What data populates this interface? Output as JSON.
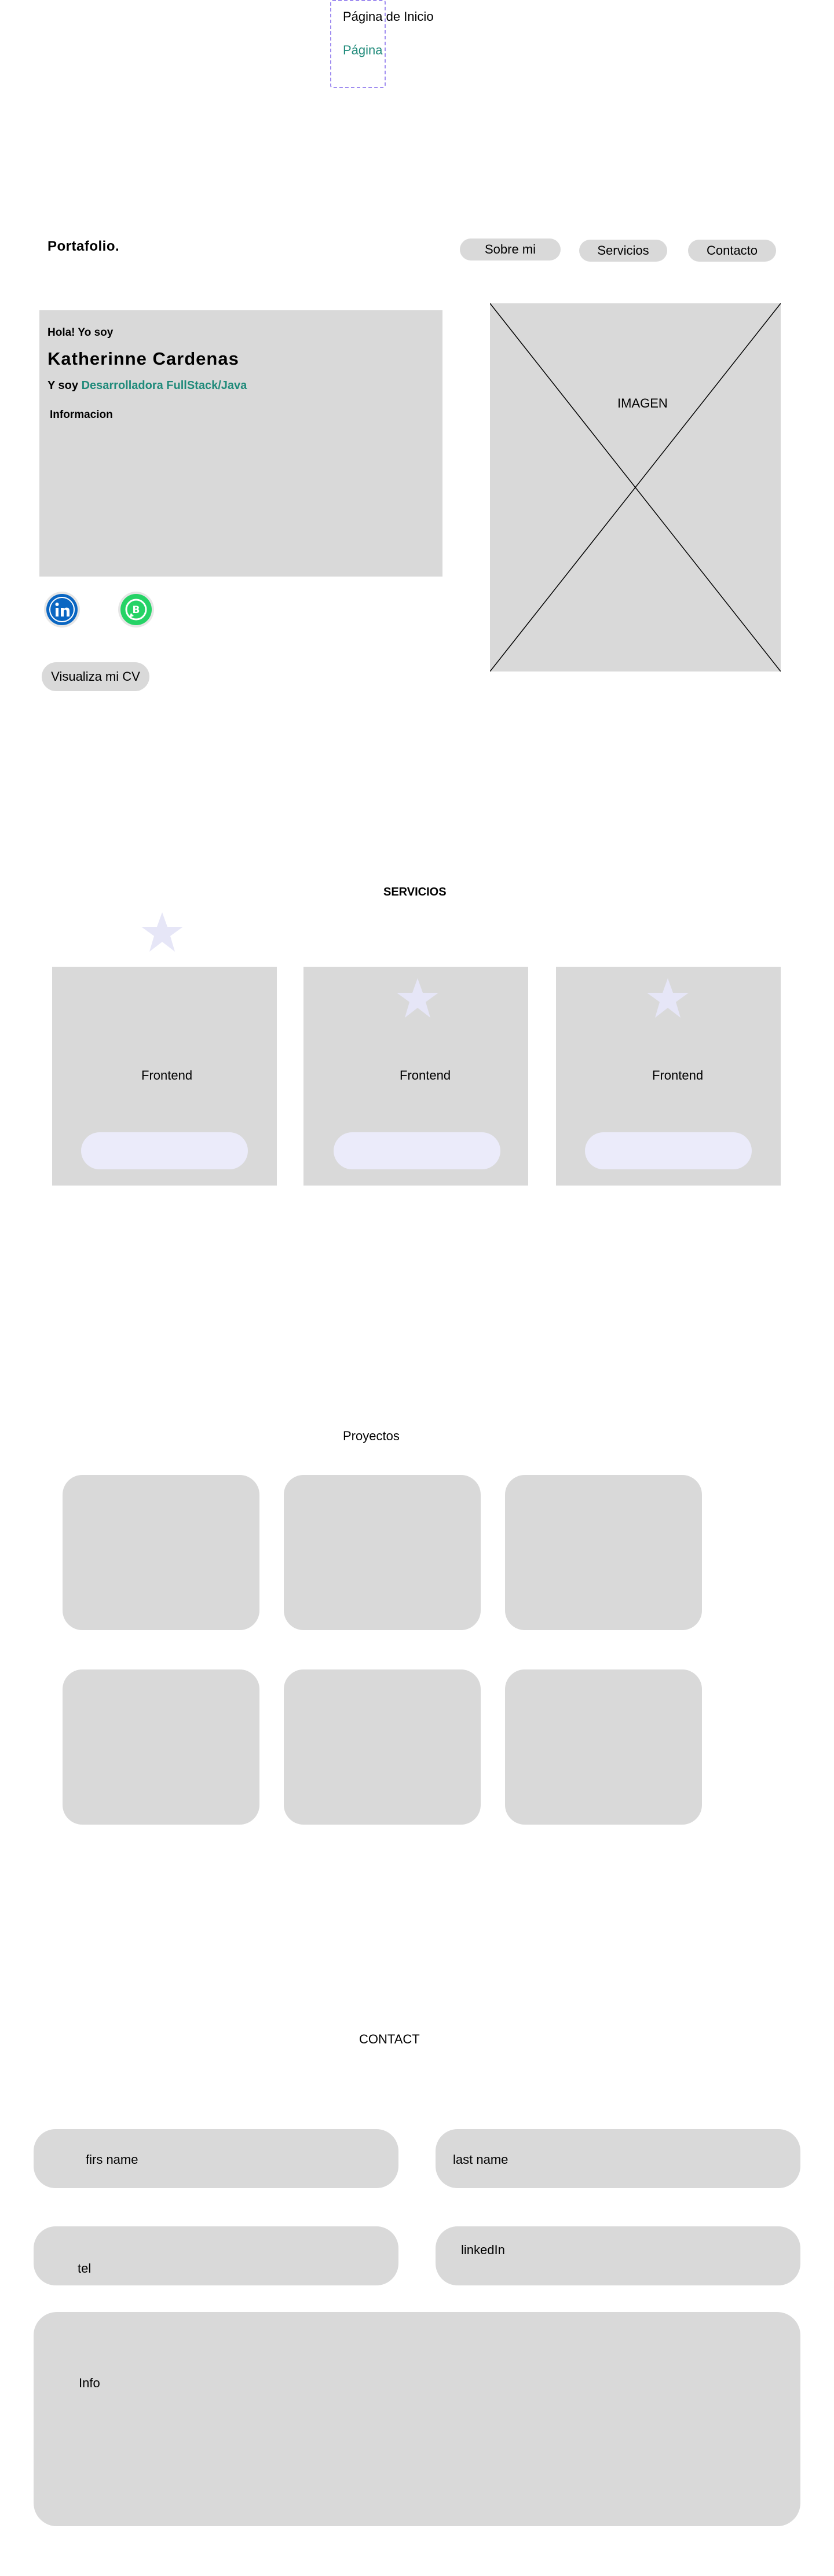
{
  "variant_frame": {
    "option_1": "Página de Inicio",
    "option_2": "Página de Inicio",
    "accent_color": "#1f8a7a",
    "frame_color": "#9f8cf0"
  },
  "header": {
    "logo": "Portafolio.",
    "nav": [
      "Sobre mi",
      "Servicios",
      "Contacto"
    ]
  },
  "hero": {
    "greeting": "Hola! Yo soy",
    "name": "Katherinne Cardenas",
    "role_prefix": "Y soy",
    "role": "Desarrolladora FullStack/Java",
    "info_label": "Informacion",
    "image_label": "IMAGEN",
    "social_icons": [
      "linkedin-icon",
      "whatsapp-business-icon"
    ],
    "cv_button": "Visualiza mi CV"
  },
  "services": {
    "title": "SERVICIOS",
    "cards": [
      {
        "label": "Frontend",
        "icon": "star-icon"
      },
      {
        "label": "Frontend",
        "icon": "star-icon"
      },
      {
        "label": "Frontend",
        "icon": "star-icon"
      }
    ]
  },
  "projects": {
    "title": "Proyectos",
    "count": 6
  },
  "contact": {
    "title": "CONTACT",
    "first_name": "firs name",
    "last_name": "last name",
    "tel": "tel",
    "linkedin": "linkedIn",
    "info": "Info"
  },
  "colors": {
    "placeholder_grey": "#d9d9d9",
    "service_button": "#ebebfa",
    "star": "#e6e6f7",
    "teal": "#1f8a7a",
    "linkedin_blue": "#0a66c2",
    "whatsapp_green": "#25d366"
  }
}
